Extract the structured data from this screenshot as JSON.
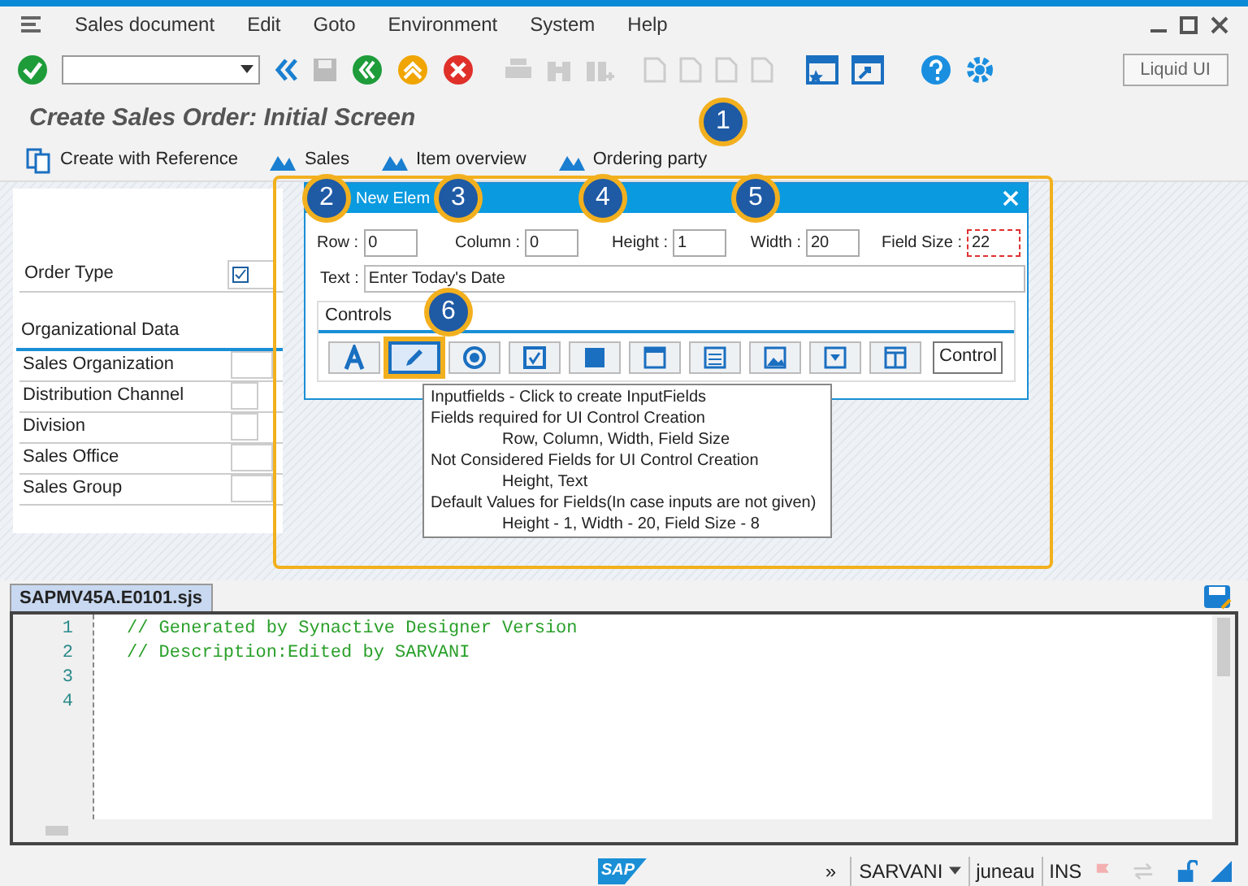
{
  "menu": [
    "Sales document",
    "Edit",
    "Goto",
    "Environment",
    "System",
    "Help"
  ],
  "toolbar": {
    "liquid_ui": "Liquid UI"
  },
  "title": "Create Sales Order: Initial Screen",
  "app_toolbar": [
    {
      "kind": "reference",
      "label": "Create with Reference"
    },
    {
      "kind": "tab",
      "label": "Sales"
    },
    {
      "kind": "tab",
      "label": "Item overview"
    },
    {
      "kind": "tab",
      "label": "Ordering party"
    }
  ],
  "form": {
    "order_type": "Order Type",
    "org_data": {
      "title": "Organizational Data",
      "fields": [
        {
          "label": "Sales Organization",
          "wide": true
        },
        {
          "label": "Distribution Channel",
          "wide": false
        },
        {
          "label": "Division",
          "wide": false
        },
        {
          "label": "Sales Office",
          "wide": true
        },
        {
          "label": "Sales Group",
          "wide": true
        }
      ]
    }
  },
  "dialog": {
    "title": "New Elem",
    "fields": [
      {
        "label": "Row :",
        "value": "0",
        "highlighted": false
      },
      {
        "label": "Column :",
        "value": "0",
        "highlighted": false
      },
      {
        "label": "Height :",
        "value": "1",
        "highlighted": false
      },
      {
        "label": "Width :",
        "value": "20",
        "highlighted": false
      },
      {
        "label": "Field Size :",
        "value": "22",
        "highlighted": true
      }
    ],
    "text": {
      "label": "Text :",
      "value": "Enter Today's Date"
    },
    "controls": {
      "title": "Controls",
      "buttons": [
        {
          "kind": "text",
          "selected": false
        },
        {
          "kind": "input",
          "selected": true
        },
        {
          "kind": "radio",
          "selected": false
        },
        {
          "kind": "checkbox",
          "selected": false
        },
        {
          "kind": "pushbutton",
          "selected": false
        },
        {
          "kind": "box",
          "selected": false
        },
        {
          "kind": "list",
          "selected": false
        },
        {
          "kind": "image",
          "selected": false
        },
        {
          "kind": "dropdown",
          "selected": false
        },
        {
          "kind": "table",
          "selected": false
        },
        {
          "kind": "label",
          "label": "Control",
          "selected": false
        }
      ]
    }
  },
  "tooltip": [
    {
      "text": "Inputfields - Click to create InputFields",
      "indent": false
    },
    {
      "text": "Fields required for UI Control Creation",
      "indent": false
    },
    {
      "text": "Row, Column, Width, Field Size",
      "indent": true
    },
    {
      "text": "Not Considered Fields for UI Control Creation",
      "indent": false
    },
    {
      "text": "Height, Text",
      "indent": true
    },
    {
      "text": "Default Values for Fields(In case inputs are not given)",
      "indent": false
    },
    {
      "text": "Height - 1, Width - 20, Field Size - 8",
      "indent": true
    }
  ],
  "callouts": [
    "1",
    "2",
    "3",
    "4",
    "5",
    "6"
  ],
  "editor": {
    "tab": "SAPMV45A.E0101.sjs",
    "lines": [
      {
        "number": "1",
        "code": "// Generated by Synactive Designer Version"
      },
      {
        "number": "2",
        "code": "// Description:Edited by SARVANI"
      },
      {
        "number": "3"
      },
      {
        "number": "4"
      }
    ]
  },
  "status": {
    "logo": "SAP",
    "user": "SARVANI",
    "server": "juneau",
    "mode": "INS",
    "more": "»"
  }
}
